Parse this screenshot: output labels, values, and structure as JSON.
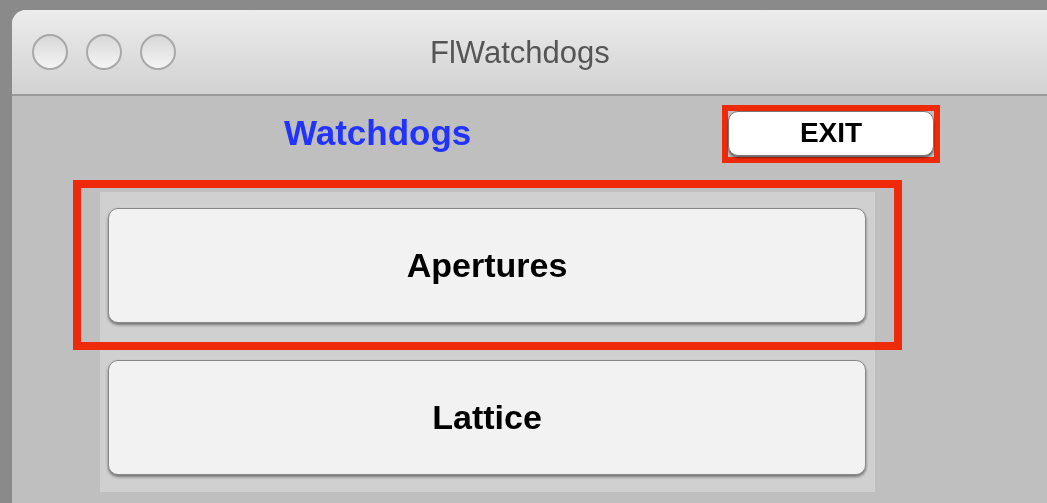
{
  "window": {
    "title": "FlWatchdogs"
  },
  "heading": "Watchdogs",
  "exit_button": {
    "label": "EXIT",
    "highlighted": true
  },
  "buttons": [
    {
      "label": "Apertures",
      "highlighted": true
    },
    {
      "label": "Lattice",
      "highlighted": false
    }
  ]
}
